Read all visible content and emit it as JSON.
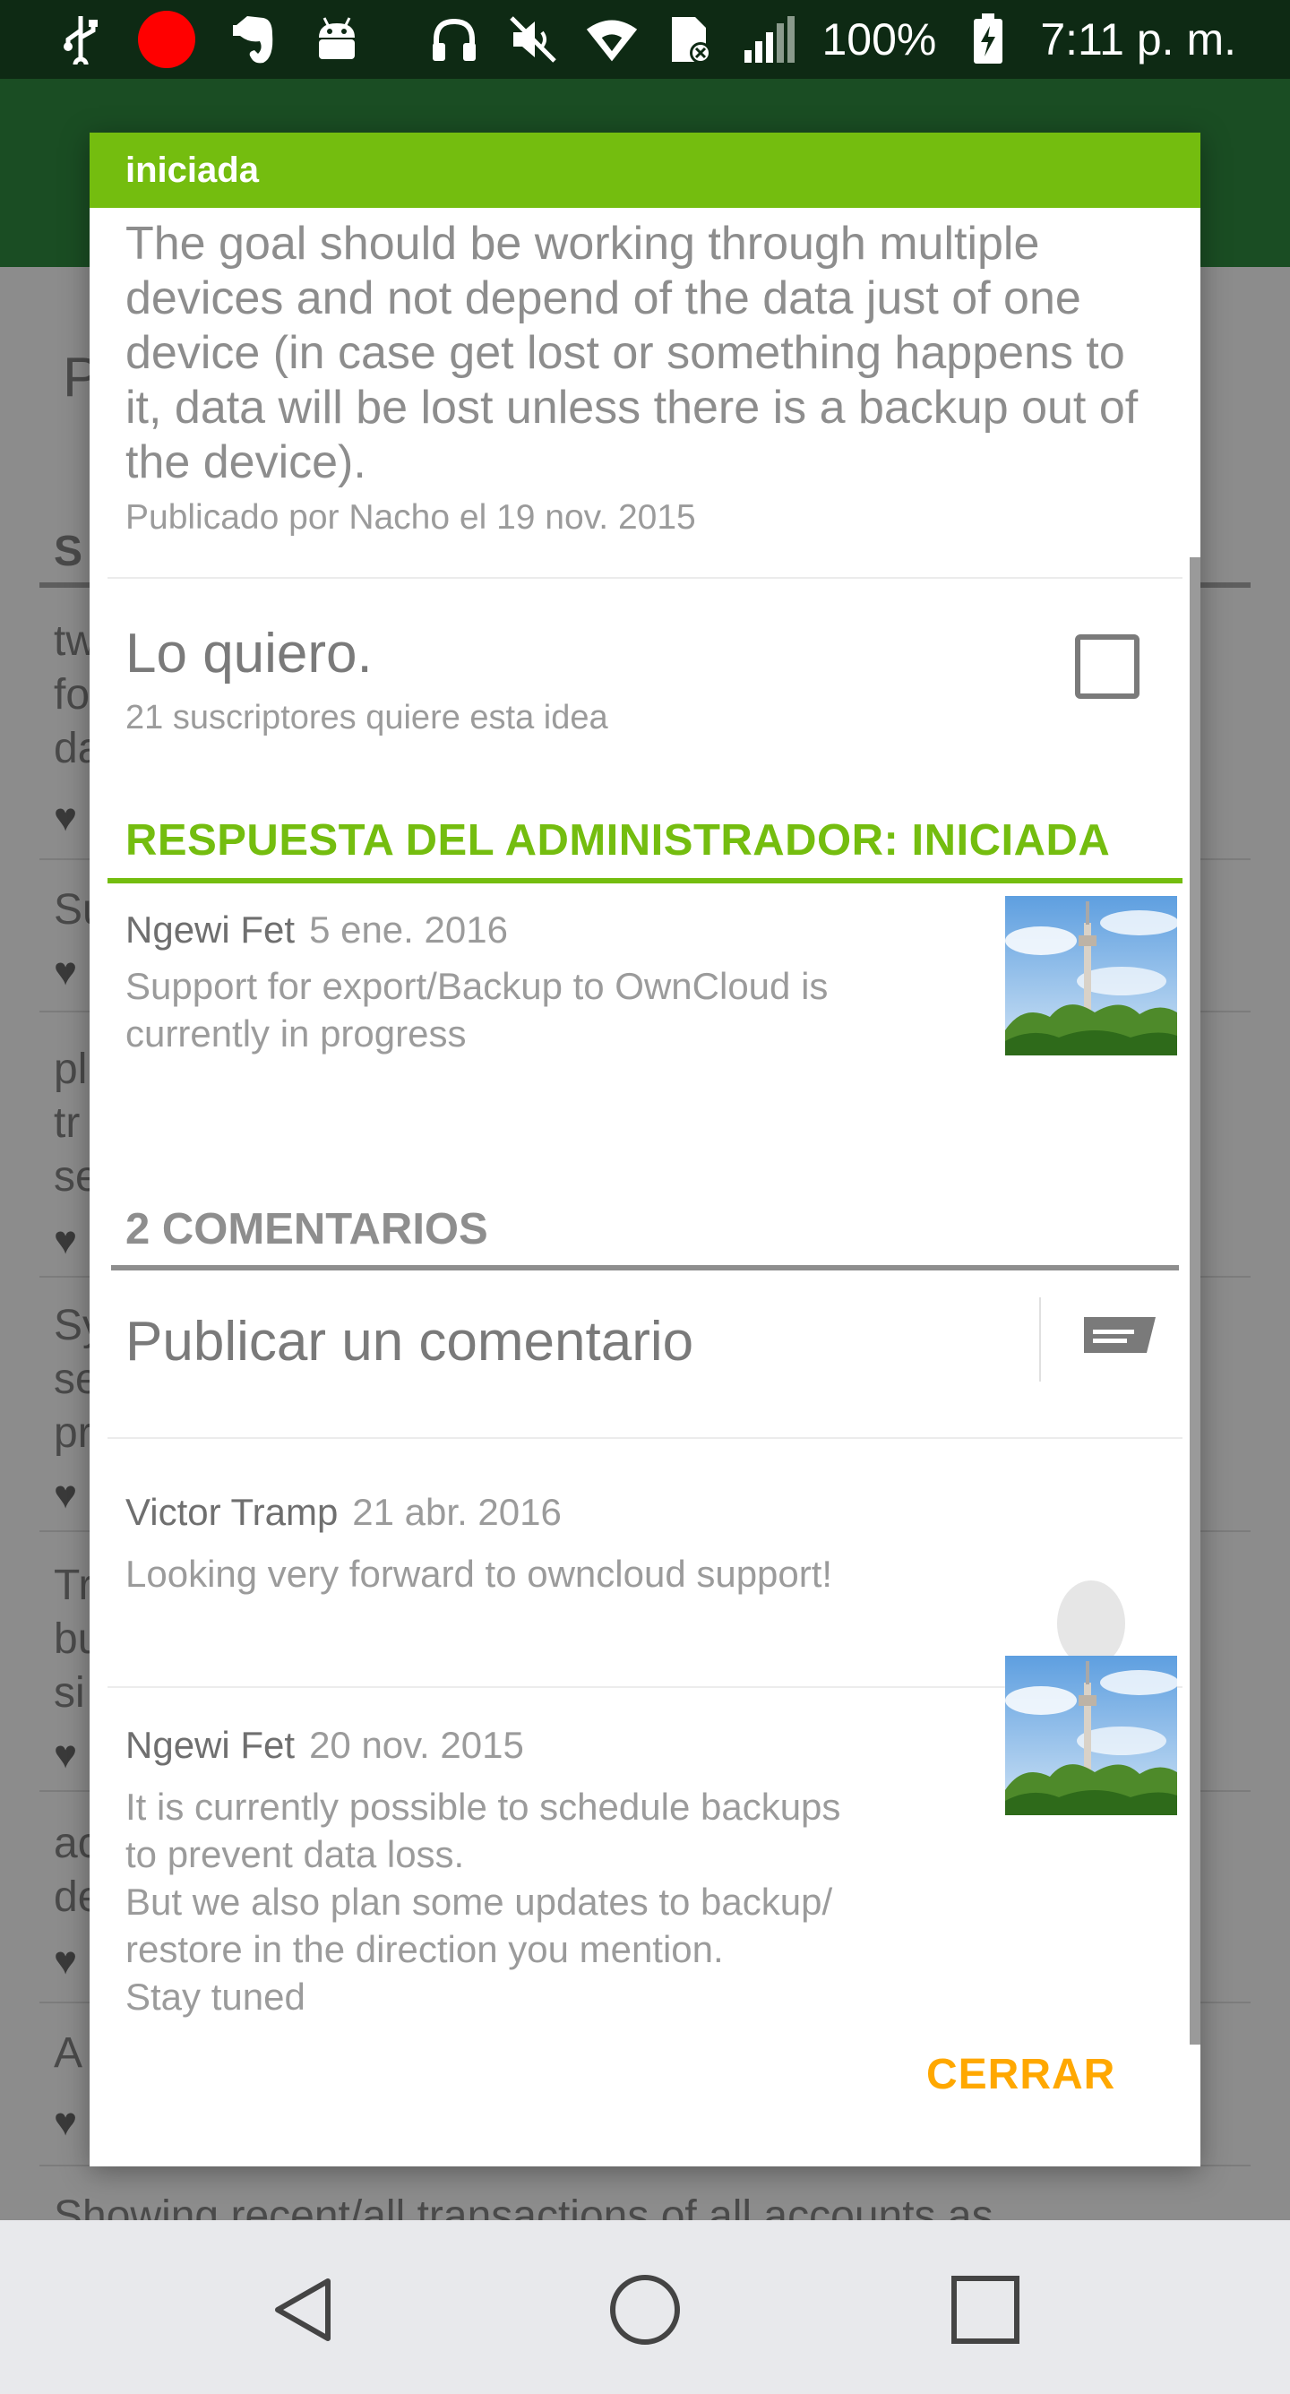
{
  "status_bar": {
    "battery": "100%",
    "time": "7:11 p. m.",
    "icons": [
      "usb-icon",
      "record-icon",
      "evernote-icon",
      "android-icon",
      "headphones-icon",
      "mute-icon",
      "wifi-icon",
      "sim-icon",
      "signal-icon",
      "battery-charging-icon"
    ]
  },
  "background": {
    "letters": [
      "P",
      "S",
      "tw",
      "fo",
      "da",
      "Su",
      "pl",
      "tr",
      "se",
      "Sy",
      "se",
      "pr",
      "Tr",
      "bu",
      "si",
      "ac",
      "de",
      "A"
    ],
    "bottom_text": "Showing recent/all transactions of all accounts as"
  },
  "dialog": {
    "header": "iniciada",
    "description": "The goal should be working through multiple devices and not depend of the data just of one device (in case get lost or something happens to it, data will be lost unless there is a backup out of the device).",
    "meta": "Publicado por Nacho el 19 nov. 2015",
    "want": {
      "title": "Lo quiero.",
      "subtitle": "21 suscriptores quiere esta idea"
    },
    "admin_response": {
      "heading": "RESPUESTA DEL ADMINISTRADOR: INICIADA",
      "author": "Ngewi Fet",
      "date": "5 ene. 2016",
      "body": "Support for export/Backup to OwnCloud is currently in progress"
    },
    "comments_heading": "2 COMENTARIOS",
    "post_comment_label": "Publicar un comentario",
    "comments": [
      {
        "author": "Victor Tramp",
        "date": "21 abr. 2016",
        "lines": [
          "Looking very forward to owncloud support!"
        ]
      },
      {
        "author": "Ngewi Fet",
        "date": "20 nov. 2015",
        "lines": [
          "It is currently possible to schedule backups",
          "to prevent data loss.",
          "But we also plan some updates to backup/",
          "restore in the direction you mention.",
          "Stay tuned"
        ]
      }
    ],
    "close_label": "CERRAR"
  },
  "colors": {
    "accent_green": "#74bd0f",
    "close_orange": "#ffa800",
    "status_bar": "#0e2a14"
  }
}
